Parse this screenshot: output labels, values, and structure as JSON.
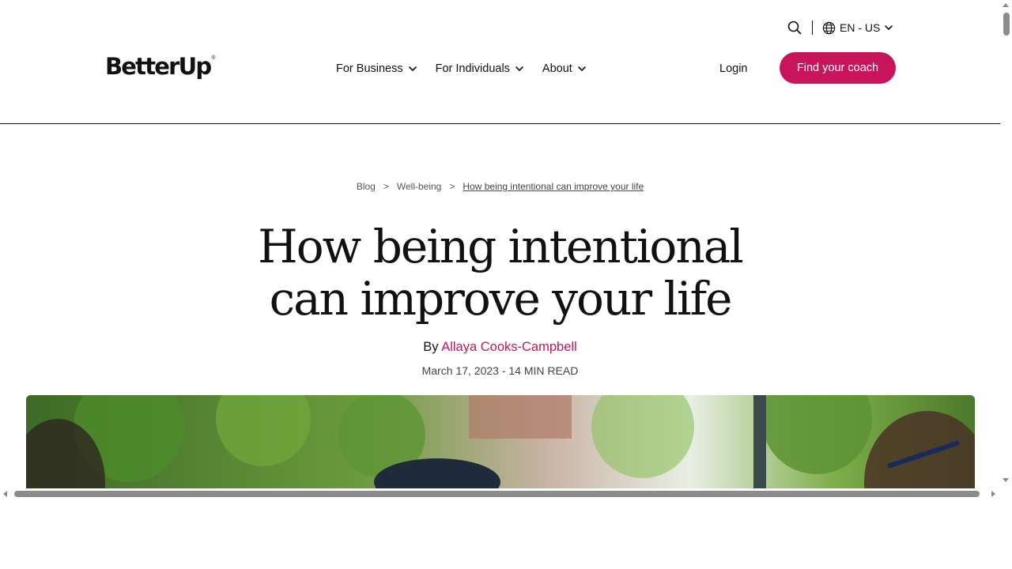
{
  "header": {
    "logo": "BetterUp",
    "logo_mark": "®",
    "language": "EN - US",
    "nav": [
      {
        "label": "For Business"
      },
      {
        "label": "For Individuals"
      },
      {
        "label": "About"
      }
    ],
    "login_label": "Login",
    "cta_label": "Find your coach",
    "icons": {
      "search": "search-icon",
      "globe": "globe-icon",
      "chevron": "chevron-down-icon"
    }
  },
  "breadcrumb": {
    "items": [
      "Blog",
      "Well-being",
      "How being intentional can improve your life"
    ],
    "separator": ">"
  },
  "article": {
    "title": "How being intentional can improve your life",
    "by_prefix": "By",
    "author": "Allaya Cooks-Campbell",
    "meta": "March 17, 2023 - 14 MIN READ"
  },
  "colors": {
    "accent": "#c8145a",
    "text": "#111111",
    "muted": "#555555"
  }
}
